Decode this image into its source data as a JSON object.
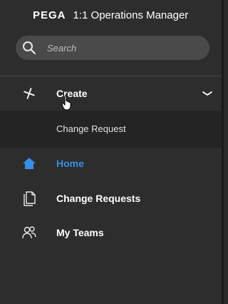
{
  "brand": {
    "logo": "PEGA",
    "app_name": "1:1 Operations Manager"
  },
  "search": {
    "placeholder": "Search"
  },
  "nav": {
    "create": {
      "label": "Create",
      "icon": "plus-icon",
      "expanded": true
    },
    "create_submenu": [
      {
        "label": "Change Request"
      }
    ],
    "items": [
      {
        "label": "Home",
        "icon": "home-icon",
        "active": true
      },
      {
        "label": "Change Requests",
        "icon": "document-icon"
      },
      {
        "label": "My Teams",
        "icon": "people-icon"
      }
    ]
  },
  "colors": {
    "background": "#2d2d2d",
    "search_bg": "#4a4a4a",
    "submenu_bg": "#242424",
    "accent": "#3a8ee6"
  }
}
